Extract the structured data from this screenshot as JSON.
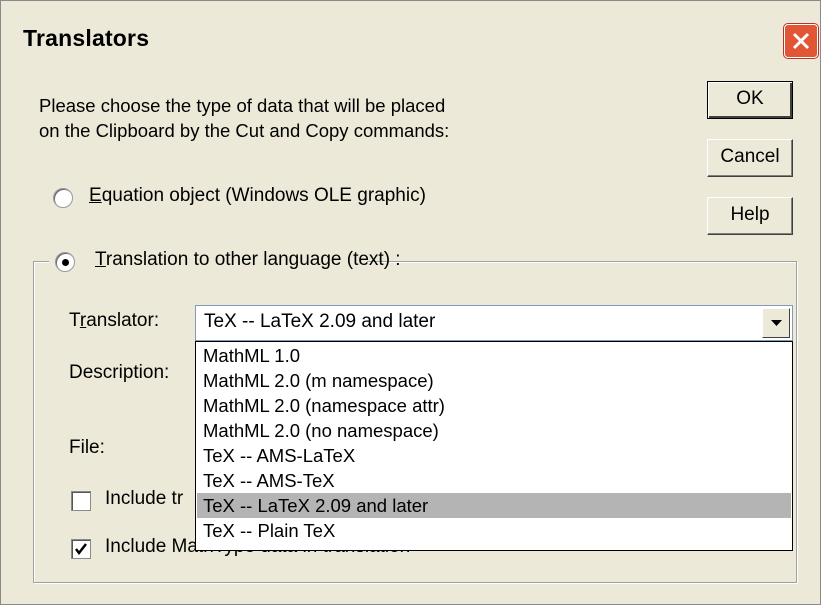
{
  "window": {
    "title": "Translators"
  },
  "prompt": "Please choose the type of data that will be placed\non the Clipboard by the Cut and Copy commands:",
  "buttons": {
    "ok": "OK",
    "cancel": "Cancel",
    "help": "Help"
  },
  "options": {
    "equation_prefix": "E",
    "equation_rest": "quation object (Windows OLE graphic)",
    "translation_prefix": "T",
    "translation_rest": "ranslation to other language (text) :",
    "selected": "translation"
  },
  "translator": {
    "label_t": "T",
    "label_r": "r",
    "label_rest": "anslator:",
    "value": "TeX -- LaTeX 2.09 and later",
    "options": [
      "MathML 1.0",
      "MathML 2.0 (m namespace)",
      "MathML 2.0 (namespace attr)",
      "MathML 2.0 (no namespace)",
      "TeX -- AMS-LaTeX",
      "TeX -- AMS-TeX",
      "TeX -- LaTeX 2.09 and later",
      "TeX -- Plain TeX"
    ],
    "selected_index": 6
  },
  "description_label": "Description:",
  "file_label": "File:",
  "checkboxes": {
    "include_tr_visible": "Include tr",
    "include_mathtype_visible_start": "Include M",
    "include_mathtype_visible_tail": "athType data in translation",
    "include_tr_checked": false,
    "include_mathtype_checked": true
  },
  "colors": {
    "close_button": "#e25535",
    "selection": "#b4b4b4",
    "dialog_bg": "#ece9d8"
  }
}
